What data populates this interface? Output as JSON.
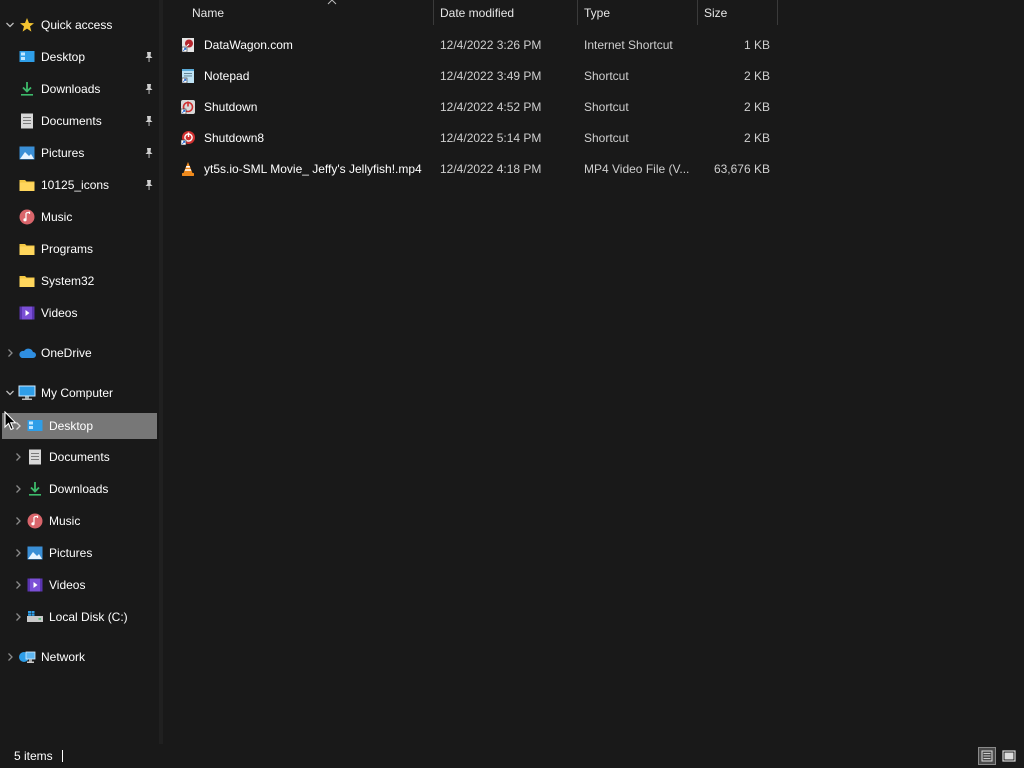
{
  "nav": {
    "quick_access": {
      "label": "Quick access",
      "items": [
        {
          "label": "Desktop",
          "icon": "desktop-icon",
          "pinned": true
        },
        {
          "label": "Downloads",
          "icon": "download-icon",
          "pinned": true
        },
        {
          "label": "Documents",
          "icon": "documents-icon",
          "pinned": true
        },
        {
          "label": "Pictures",
          "icon": "pictures-icon",
          "pinned": true
        },
        {
          "label": "10125_icons",
          "icon": "folder-icon",
          "pinned": true
        },
        {
          "label": "Music",
          "icon": "music-icon",
          "pinned": false
        },
        {
          "label": "Programs",
          "icon": "folder-icon",
          "pinned": false
        },
        {
          "label": "System32",
          "icon": "folder-icon",
          "pinned": false
        },
        {
          "label": "Videos",
          "icon": "videos-icon",
          "pinned": false
        }
      ]
    },
    "onedrive": {
      "label": "OneDrive"
    },
    "my_computer": {
      "label": "My Computer",
      "items": [
        {
          "label": "Desktop",
          "icon": "desktop-icon",
          "selected": true
        },
        {
          "label": "Documents",
          "icon": "documents-icon"
        },
        {
          "label": "Downloads",
          "icon": "download-icon"
        },
        {
          "label": "Music",
          "icon": "music-icon"
        },
        {
          "label": "Pictures",
          "icon": "pictures-icon"
        },
        {
          "label": "Videos",
          "icon": "videos-icon"
        },
        {
          "label": "Local Disk (C:)",
          "icon": "drive-icon"
        }
      ]
    },
    "network": {
      "label": "Network"
    }
  },
  "columns": {
    "name": "Name",
    "date": "Date modified",
    "type": "Type",
    "size": "Size"
  },
  "files": [
    {
      "name": "DataWagon.com",
      "date": "12/4/2022 3:26 PM",
      "type": "Internet Shortcut",
      "size": "1 KB",
      "icon": "internet-shortcut-icon"
    },
    {
      "name": "Notepad",
      "date": "12/4/2022 3:49 PM",
      "type": "Shortcut",
      "size": "2 KB",
      "icon": "notepad-icon"
    },
    {
      "name": "Shutdown",
      "date": "12/4/2022 4:52 PM",
      "type": "Shortcut",
      "size": "2 KB",
      "icon": "shutdown-icon"
    },
    {
      "name": "Shutdown8",
      "date": "12/4/2022 5:14 PM",
      "type": "Shortcut",
      "size": "2 KB",
      "icon": "shutdown-red-icon"
    },
    {
      "name": "yt5s.io-SML Movie_ Jeffy's Jellyfish!.mp4",
      "date": "12/4/2022 4:18 PM",
      "type": "MP4 Video File (V...",
      "size": "63,676 KB",
      "icon": "vlc-icon"
    }
  ],
  "status": {
    "count": "5 items"
  },
  "colors": {
    "background": "#191919",
    "selected": "#777777",
    "text": "#ffffff"
  }
}
